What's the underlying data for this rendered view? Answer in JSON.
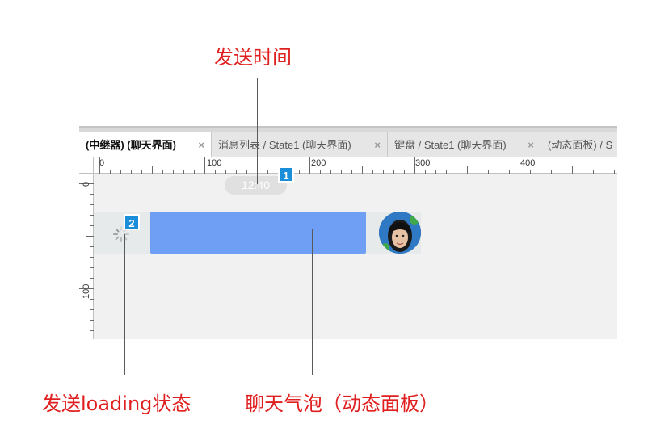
{
  "annotations": {
    "send_time": "发送时间",
    "send_loading": "发送loading状态",
    "chat_bubble": "聊天气泡（动态面板）"
  },
  "tabs": [
    {
      "label": "(中继器) (聊天界面)",
      "active": true
    },
    {
      "label": "消息列表 / State1 (聊天界面)",
      "active": false
    },
    {
      "label": "键盘 / State1 (聊天界面)",
      "active": false
    },
    {
      "label": "(动态面板) / S",
      "active": false
    }
  ],
  "close_glyph": "×",
  "ruler": {
    "horizontal": [
      "0",
      "100",
      "200",
      "300",
      "400"
    ],
    "vertical": [
      "0",
      "100"
    ]
  },
  "chat": {
    "time": "12:40",
    "marker_1": "1",
    "marker_2": "2"
  },
  "colors": {
    "annotation": "#e02020",
    "bubble": "#6f9ff5",
    "marker": "#1a8ed8"
  },
  "icons": [
    "close-icon",
    "loading-spinner-icon",
    "avatar-photo"
  ]
}
